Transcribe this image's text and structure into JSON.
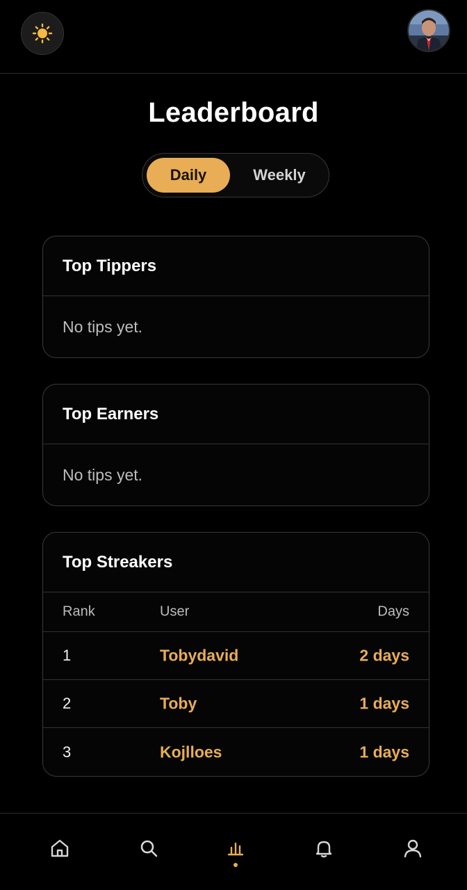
{
  "header": {
    "theme_toggle_icon": "sun-icon",
    "avatar_icon": "user-avatar"
  },
  "page": {
    "title": "Leaderboard"
  },
  "period_tabs": {
    "daily": "Daily",
    "weekly": "Weekly",
    "selected": "Daily"
  },
  "top_tippers": {
    "title": "Top Tippers",
    "empty_text": "No tips yet."
  },
  "top_earners": {
    "title": "Top Earners",
    "empty_text": "No tips yet."
  },
  "top_streakers": {
    "title": "Top Streakers",
    "columns": {
      "rank": "Rank",
      "user": "User",
      "days": "Days"
    },
    "rows": [
      {
        "rank": "1",
        "user": "Tobydavid",
        "days": "2 days"
      },
      {
        "rank": "2",
        "user": "Toby",
        "days": "1 days"
      },
      {
        "rank": "3",
        "user": "Kojlloes",
        "days": "1 days"
      }
    ]
  },
  "bottom_nav": {
    "items": [
      "home-icon",
      "search-icon",
      "leaderboard-icon",
      "bell-icon",
      "profile-icon"
    ],
    "active": "leaderboard-icon"
  },
  "colors": {
    "accent": "#e9ad55",
    "background": "#000000",
    "border": "#3a3a3a"
  }
}
